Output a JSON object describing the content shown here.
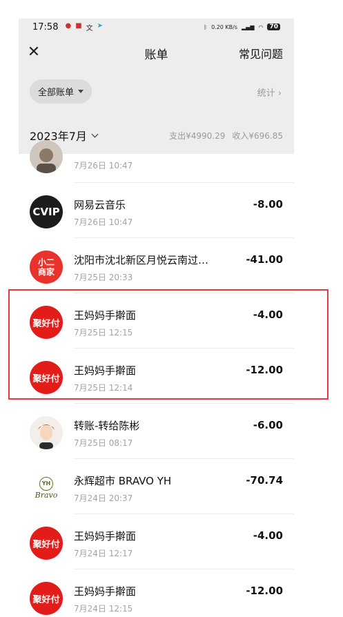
{
  "status_bar": {
    "time": "17:58",
    "left_icons": [
      "baidu-paw-icon",
      "app-badge-icon",
      "translate-icon",
      "telegram-icon"
    ],
    "net_speed": "0.20 KB/s",
    "battery": "70"
  },
  "header": {
    "title": "账单",
    "close_icon": "close-icon",
    "faq_label": "常见问题",
    "filter_label": "全部账单",
    "stats_label": "统计",
    "month_label": "2023年7月",
    "expense_summary": "支出¥4990.29",
    "income_summary": "收入¥696.85"
  },
  "transactions": [
    {
      "name": "",
      "time": "7月26日 10:47",
      "amount": "",
      "avatar": "person-photo"
    },
    {
      "name": "网易云音乐",
      "time": "7月26日 10:47",
      "amount": "-8.00",
      "avatar": "cvip-logo",
      "avatar_text": "CVIP"
    },
    {
      "name": "沈阳市沈北新区月悦云南过…",
      "time": "7月25日 20:33",
      "amount": "-41.00",
      "avatar": "xiaoer-shangjia-logo",
      "avatar_text_1": "小二",
      "avatar_text_2": "商家"
    },
    {
      "name": "王妈妈手擀面",
      "time": "7月25日 12:15",
      "amount": "-4.00",
      "avatar": "juhaofu-logo",
      "avatar_text": "聚好付"
    },
    {
      "name": "王妈妈手擀面",
      "time": "7月25日 12:14",
      "amount": "-12.00",
      "avatar": "juhaofu-logo",
      "avatar_text": "聚好付"
    },
    {
      "name": "转账-转给陈彬",
      "time": "7月25日 08:17",
      "amount": "-6.00",
      "avatar": "cartoon-person"
    },
    {
      "name": "永辉超市 BRAVO YH",
      "time": "7月24日 20:37",
      "amount": "-70.74",
      "avatar": "yh-bravo-logo",
      "avatar_text_1": "YH",
      "avatar_text_2": "Bravo"
    },
    {
      "name": "王妈妈手擀面",
      "time": "7月24日 12:17",
      "amount": "-4.00",
      "avatar": "juhaofu-logo",
      "avatar_text": "聚好付"
    },
    {
      "name": "王妈妈手擀面",
      "time": "7月24日 12:15",
      "amount": "-12.00",
      "avatar": "juhaofu-logo",
      "avatar_text": "聚好付"
    }
  ],
  "colors": {
    "header_bg": "#ededed",
    "accent_red": "#e21b1b",
    "highlight_border": "#e23b3b",
    "muted_text": "#a3a3a3"
  }
}
